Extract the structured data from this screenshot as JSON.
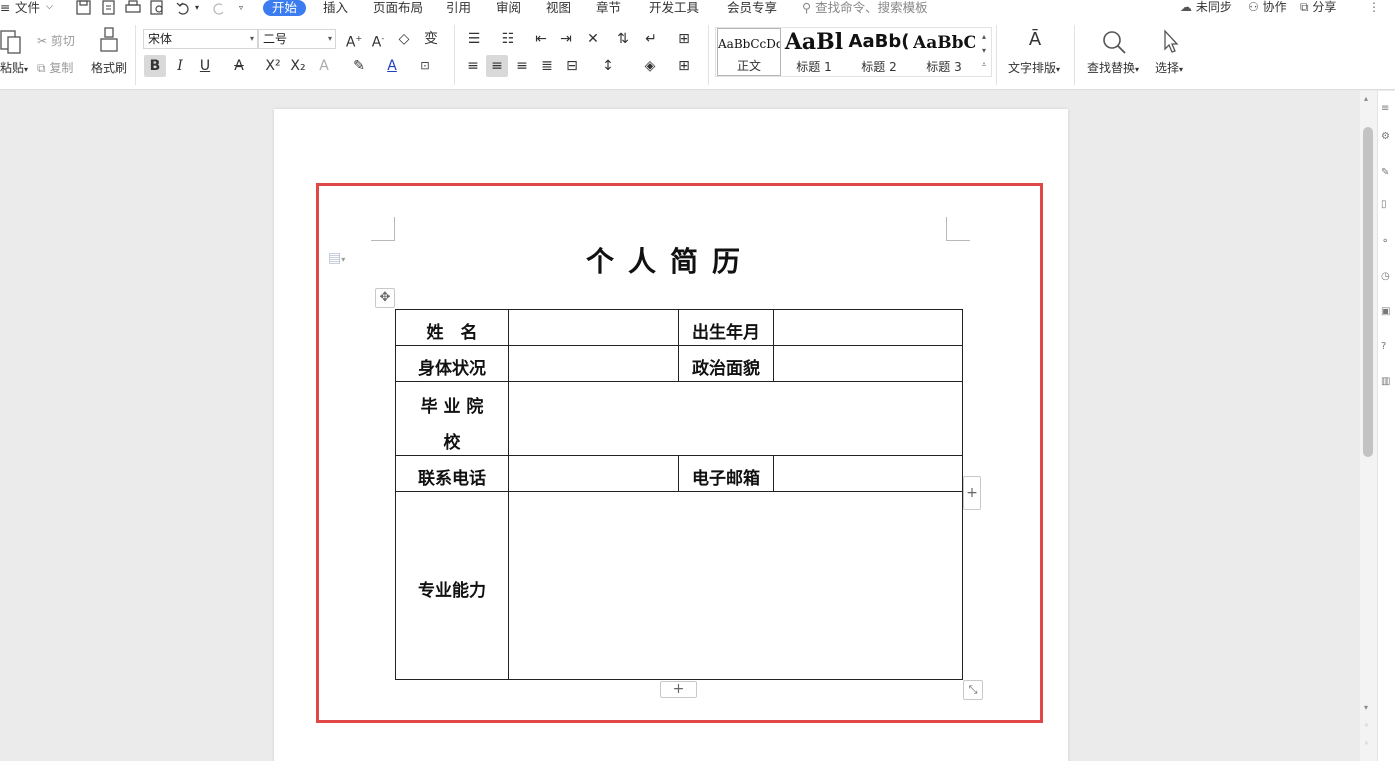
{
  "menu": {
    "file_label": "文件",
    "tabs": [
      "开始",
      "插入",
      "页面布局",
      "引用",
      "审阅",
      "视图",
      "章节",
      "开发工具",
      "会员专享"
    ],
    "active_tab": "开始",
    "search_placeholder": "查找命令、搜索模板",
    "sync_label": "未同步",
    "collab_label": "协作",
    "share_label": "分享"
  },
  "ribbon": {
    "paste_label": "粘贴",
    "cut_label": "剪切",
    "copy_label": "复制",
    "format_painter_label": "格式刷",
    "font_name": "宋体",
    "font_size": "二号",
    "styles": [
      {
        "sample": "AaBbCcDd",
        "name": "正文"
      },
      {
        "sample": "AaBl",
        "name": "标题 1"
      },
      {
        "sample": "AaBb(",
        "name": "标题 2"
      },
      {
        "sample": "AaBbC",
        "name": "标题 3"
      }
    ],
    "text_layout_label": "文字排版",
    "find_replace_label": "查找替换",
    "select_label": "选择"
  },
  "document": {
    "title": "个人简历",
    "table": {
      "name_label": "姓　名",
      "birth_label": "出生年月",
      "health_label": "身体状况",
      "politics_label": "政治面貌",
      "school_label_line1": "毕 业 院",
      "school_label_line2": "校",
      "phone_label": "联系电话",
      "email_label": "电子邮箱",
      "skills_label": "专业能力"
    }
  },
  "colors": {
    "accent": "#3b7cf0",
    "highlight_border": "#e04848",
    "page_background": "#ebebeb"
  }
}
